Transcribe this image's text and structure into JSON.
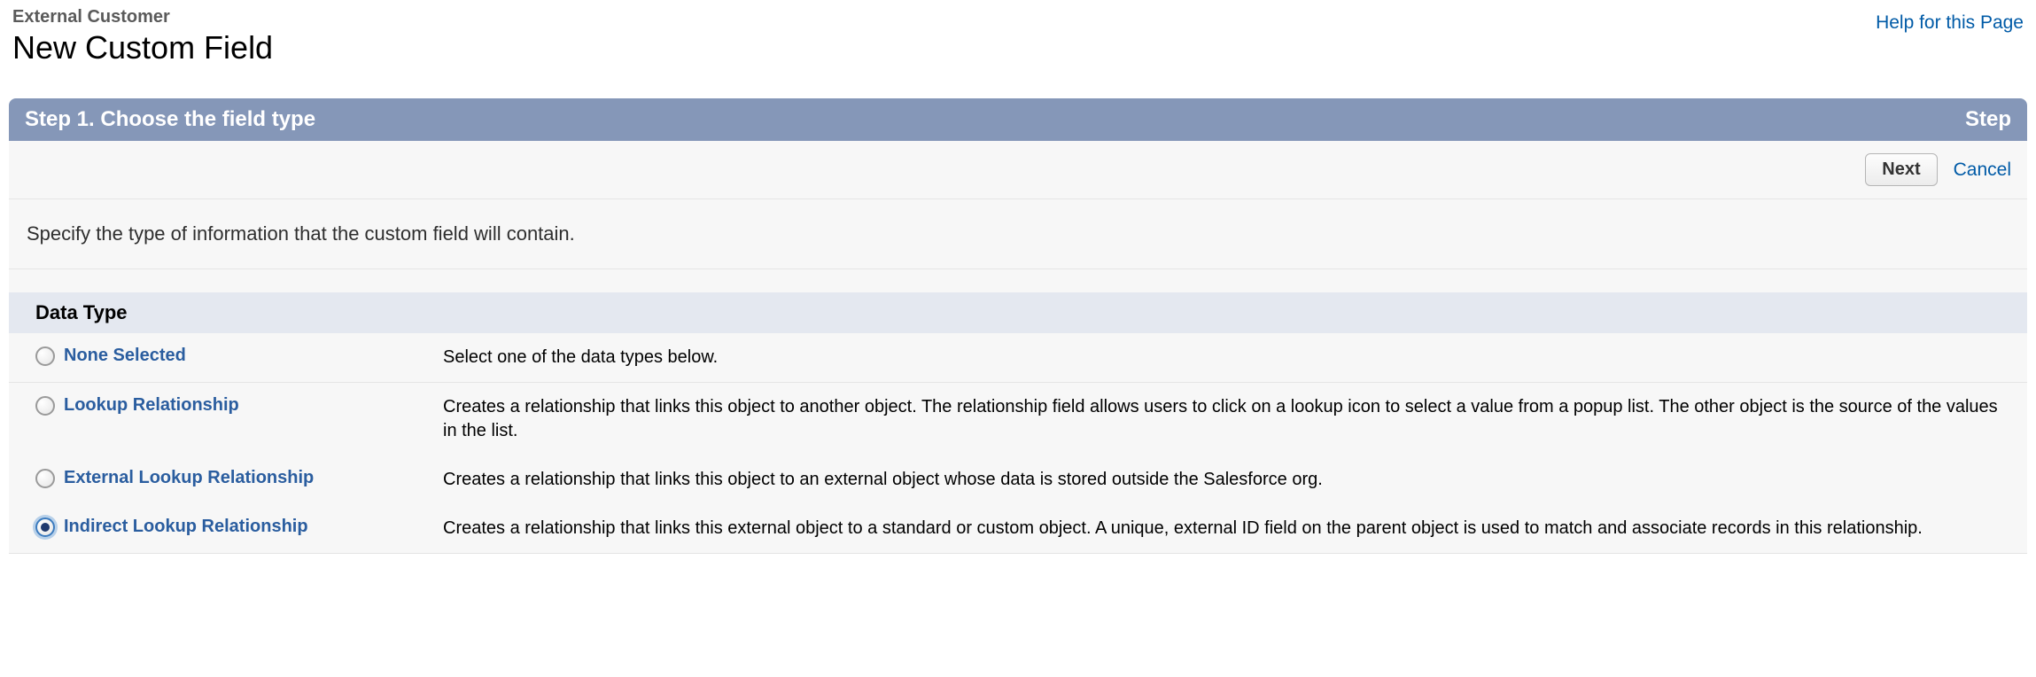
{
  "header": {
    "breadcrumb": "External Customer",
    "title": "New Custom Field",
    "help_link": "Help for this Page"
  },
  "step": {
    "title": "Step 1. Choose the field type",
    "indicator": "Step"
  },
  "buttons": {
    "next": "Next",
    "cancel": "Cancel"
  },
  "instruction": "Specify the type of information that the custom field will contain.",
  "section_title": "Data Type",
  "types": [
    {
      "label": "None Selected",
      "description": "Select one of the data types below.",
      "selected": false,
      "first_group": true
    },
    {
      "label": "Lookup Relationship",
      "description": "Creates a relationship that links this object to another object. The relationship field allows users to click on a lookup icon to select a value from a popup list. The other object is the source of the values in the list.",
      "selected": false,
      "first_group": false
    },
    {
      "label": "External Lookup Relationship",
      "description": "Creates a relationship that links this object to an external object whose data is stored outside the Salesforce org.",
      "selected": false,
      "first_group": false
    },
    {
      "label": "Indirect Lookup Relationship",
      "description": "Creates a relationship that links this external object to a standard or custom object. A unique, external ID field on the parent object is used to match and associate records in this relationship.",
      "selected": true,
      "first_group": false
    }
  ]
}
